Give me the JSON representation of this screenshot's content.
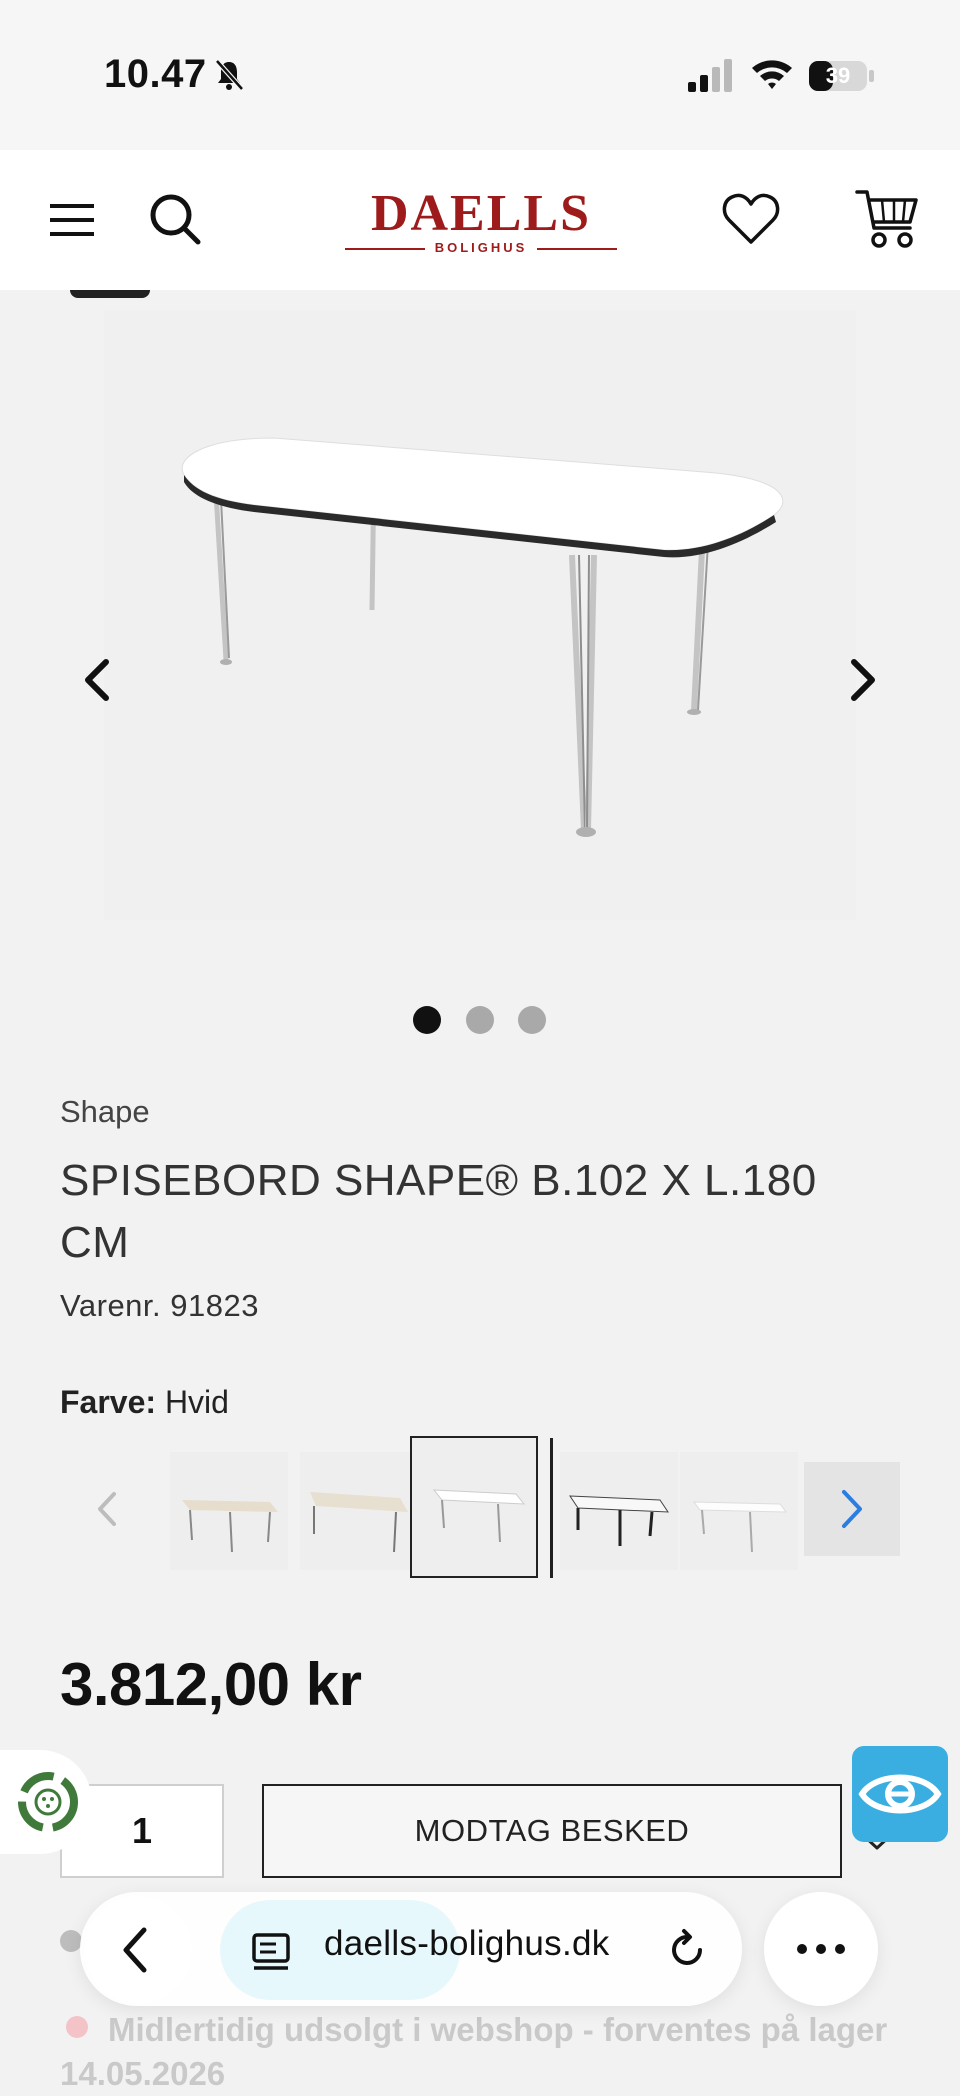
{
  "status_bar": {
    "time": "10.47",
    "battery_level": "39"
  },
  "header": {
    "logo_text": "DAELLS",
    "logo_subtext": "BOLIGHUS",
    "brand_color": "#9e1b1b",
    "icons": [
      "menu-icon",
      "search-icon",
      "heart-icon",
      "cart-icon"
    ]
  },
  "gallery": {
    "image_count": 3,
    "active_index": 0
  },
  "product": {
    "brand": "Shape",
    "title": "SPISEBORD SHAPE® B.102 X L.180 CM",
    "sku_label": "Varenr.",
    "sku": "91823",
    "color_label": "Farve:",
    "color_value": "Hvid",
    "swatches": [
      {
        "name": "oak-light"
      },
      {
        "name": "oak-natural"
      },
      {
        "name": "white",
        "selected": true
      },
      {
        "name": "black"
      },
      {
        "name": "white-laminate"
      }
    ],
    "price": "3.812,00 kr",
    "quantity": "1",
    "notify_button": "MODTAG BESKED",
    "stock_status": "Midlertidig udsolgt i webshop - forventes på lager 14.05.2026"
  },
  "browser": {
    "url": "daells-bolighus.dk"
  },
  "colors": {
    "accent_blue": "#3aaee0",
    "stock_dot": "#f3c3c8"
  }
}
